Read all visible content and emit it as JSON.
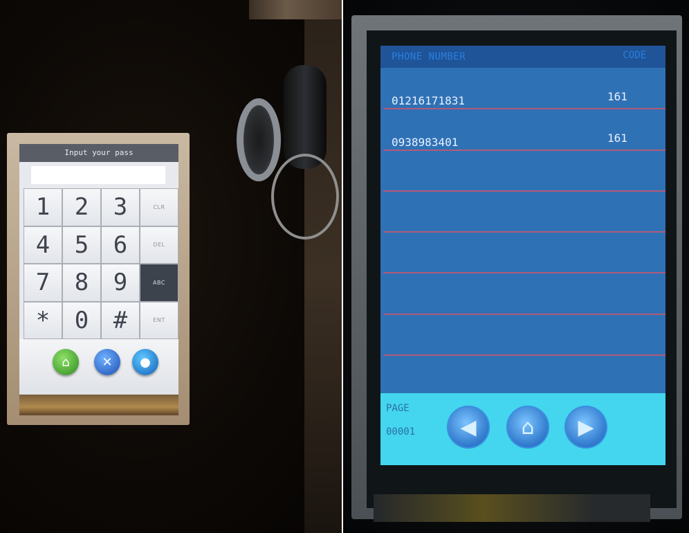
{
  "left_device": {
    "title": "Input your pass",
    "input_value": "",
    "keys": [
      {
        "label": "1",
        "type": "num"
      },
      {
        "label": "2",
        "type": "num"
      },
      {
        "label": "3",
        "type": "num"
      },
      {
        "label": "CLR",
        "type": "fn"
      },
      {
        "label": "4",
        "type": "num"
      },
      {
        "label": "5",
        "type": "num"
      },
      {
        "label": "6",
        "type": "num"
      },
      {
        "label": "DEL",
        "type": "fn"
      },
      {
        "label": "7",
        "type": "num"
      },
      {
        "label": "8",
        "type": "num"
      },
      {
        "label": "9",
        "type": "num"
      },
      {
        "label": "ABC",
        "type": "fn-dark"
      },
      {
        "label": "*",
        "type": "num"
      },
      {
        "label": "0",
        "type": "num"
      },
      {
        "label": "#",
        "type": "num"
      },
      {
        "label": "ENT",
        "type": "fn"
      }
    ],
    "icons": [
      "home-icon",
      "tools-icon",
      "info-icon"
    ]
  },
  "right_device": {
    "header": {
      "phone": "PHONE NUMBER",
      "code": "CODE"
    },
    "rows": [
      {
        "phone": "01216171831",
        "code": "161"
      },
      {
        "phone": "0938983401",
        "code": "161"
      }
    ],
    "page_label": "PAGE",
    "page_number": "00001",
    "nav_icons": [
      "arrow-left-icon",
      "home-icon",
      "arrow-right-icon"
    ]
  },
  "colors": {
    "screen_blue": "#2f71b5",
    "header_blue": "#1f5498",
    "row_line": "#b25a7a",
    "nav_cyan": "#43d6ee",
    "keypad_title": "#595d66"
  }
}
